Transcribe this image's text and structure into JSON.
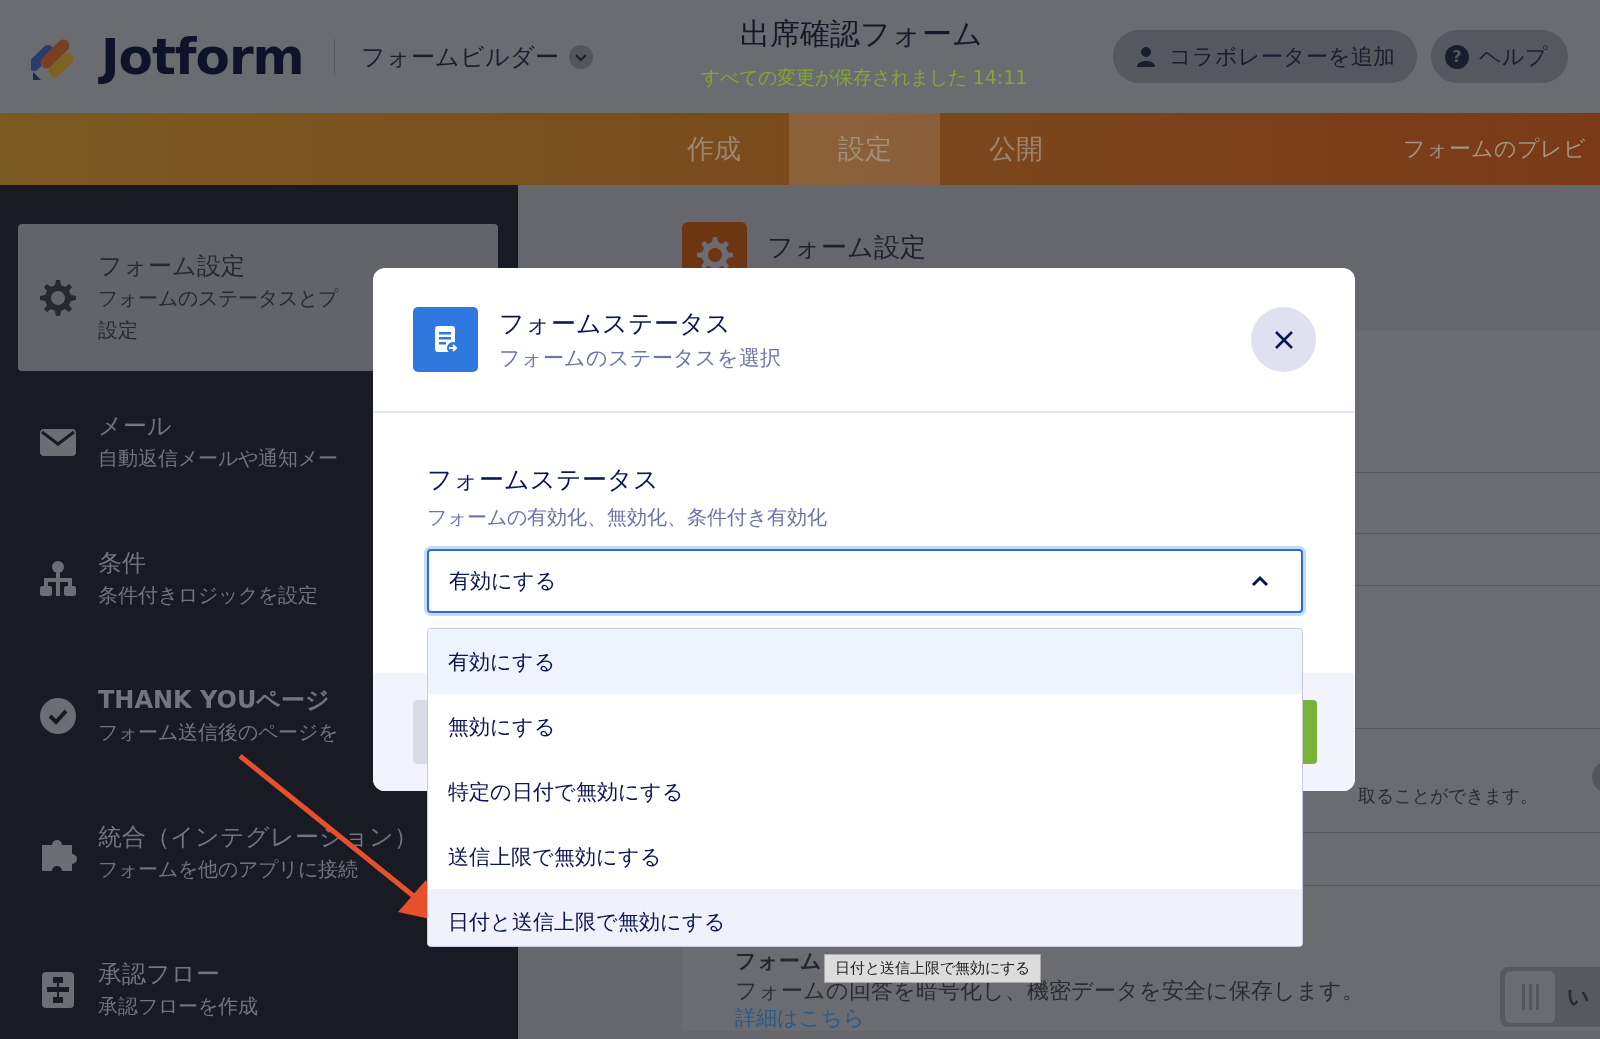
{
  "header": {
    "logo": "Jotform",
    "builder_menu": "フォームビルダー",
    "form_title": "出席確認フォーム",
    "save_status": "すべての変更が保存されました 14:11",
    "buttons": [
      {
        "kind": "collaborator",
        "label": "コラボレーターを追加"
      },
      {
        "kind": "help",
        "icon": "?",
        "label": "ヘルプ"
      }
    ]
  },
  "tabs": [
    {
      "label": "作成",
      "selected": false
    },
    {
      "label": "設定",
      "selected": true
    },
    {
      "label": "公開",
      "selected": false
    }
  ],
  "preview_link": "フォームのプレビ",
  "sidebar": {
    "items": [
      {
        "kind": "gear",
        "title": "フォーム設定",
        "description": [
          "フォームのステータスとプ",
          "設定"
        ],
        "selected": true
      },
      {
        "kind": "mail",
        "title": "メール",
        "description": [
          "自動返信メールや通知メー"
        ],
        "selected": false
      },
      {
        "kind": "conditions",
        "title": "条件",
        "description": [
          "条件付きロジックを設定"
        ],
        "selected": false
      },
      {
        "kind": "check",
        "title": "THANK YOUページ",
        "description": [
          "フォーム送信後のページを"
        ],
        "selected": false
      },
      {
        "kind": "puzzle",
        "title": "統合（インテグレーション）",
        "description": [
          "フォームを他のアプリに接続"
        ],
        "selected": false
      },
      {
        "kind": "flow",
        "title": "承認フロー",
        "description": [
          "承認フローを作成"
        ],
        "selected": false
      }
    ]
  },
  "content": {
    "heading": "フォーム設定",
    "partial_text": "取ることができます。",
    "partial_toggle": {
      "on": false
    },
    "encryption": {
      "heading": "フォーム",
      "description": "フォームの回答を暗号化し、機密データを安全に保存します。",
      "link": "詳細はこちら",
      "toggle": {
        "label": "い",
        "on": false
      }
    }
  },
  "modal": {
    "title": "フォームステータス",
    "subtitle": "フォームのステータスを選択",
    "field_label": "フォームステータス",
    "field_hint": "フォームの有効化、無効化、条件付き有効化",
    "value": "有効にする",
    "expanded": true,
    "options": [
      {
        "label": "有効にする",
        "selected": true,
        "hovered": false
      },
      {
        "label": "無効にする",
        "selected": false,
        "hovered": false
      },
      {
        "label": "特定の日付で無効にする",
        "selected": false,
        "hovered": false
      },
      {
        "label": "送信上限で無効にする",
        "selected": false,
        "hovered": false
      },
      {
        "label": "日付と送信上限で無効にする",
        "selected": false,
        "hovered": true
      }
    ]
  },
  "tooltip": "日付と送信上限で無効にする"
}
